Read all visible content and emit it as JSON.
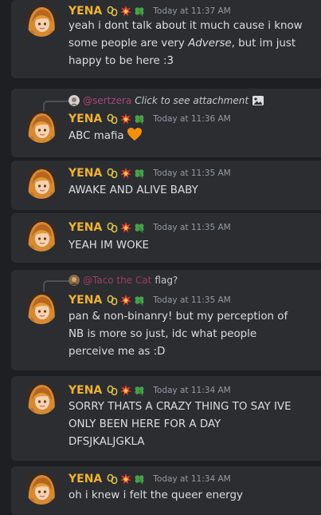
{
  "messages": [
    {
      "username": "YENA",
      "badges": [
        "chain-icon",
        "collision-icon",
        "clover-icon"
      ],
      "timestamp": "Today at 11:37 AM",
      "lines": [
        "yeah i dont talk about it much cause i know",
        "some people are very ",
        "Adverse",
        ", but im just",
        "happy to be here :3"
      ]
    },
    {
      "reply": {
        "user": "@sertzera",
        "text": "Click to see attachment",
        "icon": "image-icon"
      },
      "username": "YENA",
      "badges": [
        "chain-icon",
        "collision-icon",
        "clover-icon"
      ],
      "timestamp": "Today at 11:36 AM",
      "text": "ABC mafia",
      "emoji": "orange-heart-icon"
    },
    {
      "username": "YENA",
      "badges": [
        "chain-icon",
        "collision-icon",
        "clover-icon"
      ],
      "timestamp": "Today at 11:35 AM",
      "text": "AWAKE AND ALIVE BABY"
    },
    {
      "username": "YENA",
      "badges": [
        "chain-icon",
        "collision-icon",
        "clover-icon"
      ],
      "timestamp": "Today at 11:35 AM",
      "text": "YEAH IM WOKE"
    },
    {
      "reply": {
        "user": "@Taco the Cat",
        "text": "flag?"
      },
      "username": "YENA",
      "badges": [
        "chain-icon",
        "collision-icon",
        "clover-icon"
      ],
      "timestamp": "Today at 11:35 AM",
      "lines": [
        "pan & non-binanry! but my perception of",
        "NB is more so just, idc what people",
        "perceive me as :D"
      ]
    },
    {
      "username": "YENA",
      "badges": [
        "chain-icon",
        "collision-icon",
        "clover-icon"
      ],
      "timestamp": "Today at 11:34 AM",
      "lines": [
        "SORRY THATS A CRAZY THING TO SAY IVE",
        "ONLY BEEN HERE FOR A DAY",
        "DFSJKALJGKLA"
      ]
    },
    {
      "username": "YENA",
      "badges": [
        "chain-icon",
        "collision-icon",
        "clover-icon"
      ],
      "timestamp": "Today at 11:34 AM",
      "text": "oh i knew i felt the queer energy"
    }
  ],
  "colors": {
    "background": "#1e1f22",
    "message_bg": "#2b2d31",
    "username": "#f0b232",
    "timestamp": "#949ba4",
    "text": "#dbdee1",
    "reply_user": "#a6467a"
  }
}
